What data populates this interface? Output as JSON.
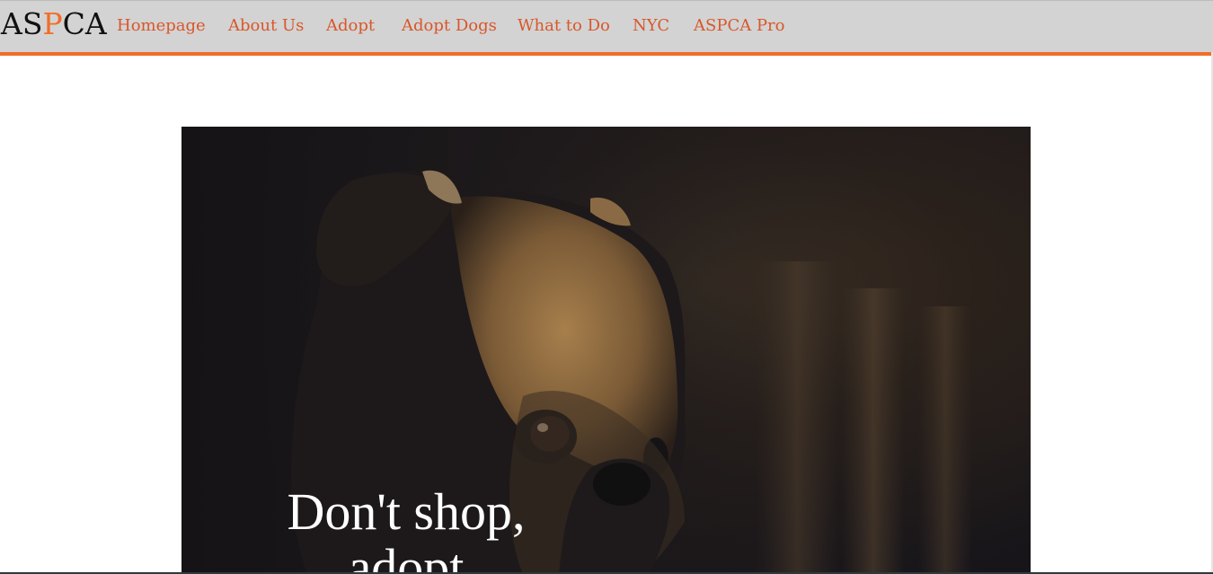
{
  "nav": {
    "logo": {
      "prefix": "AS",
      "accent": "P",
      "suffix": "CA"
    },
    "links": [
      {
        "label": "Homepage"
      },
      {
        "label": "About Us"
      },
      {
        "label": "Adopt"
      },
      {
        "label": "Adopt Dogs"
      },
      {
        "label": "What to Do"
      },
      {
        "label": "NYC"
      },
      {
        "label": "ASPCA Pro"
      }
    ]
  },
  "hero": {
    "line1": "Don't shop,",
    "line2": "adopt"
  },
  "colors": {
    "accent": "#f26d26",
    "link": "#d9572a",
    "navbar": "#d3d3d3"
  }
}
